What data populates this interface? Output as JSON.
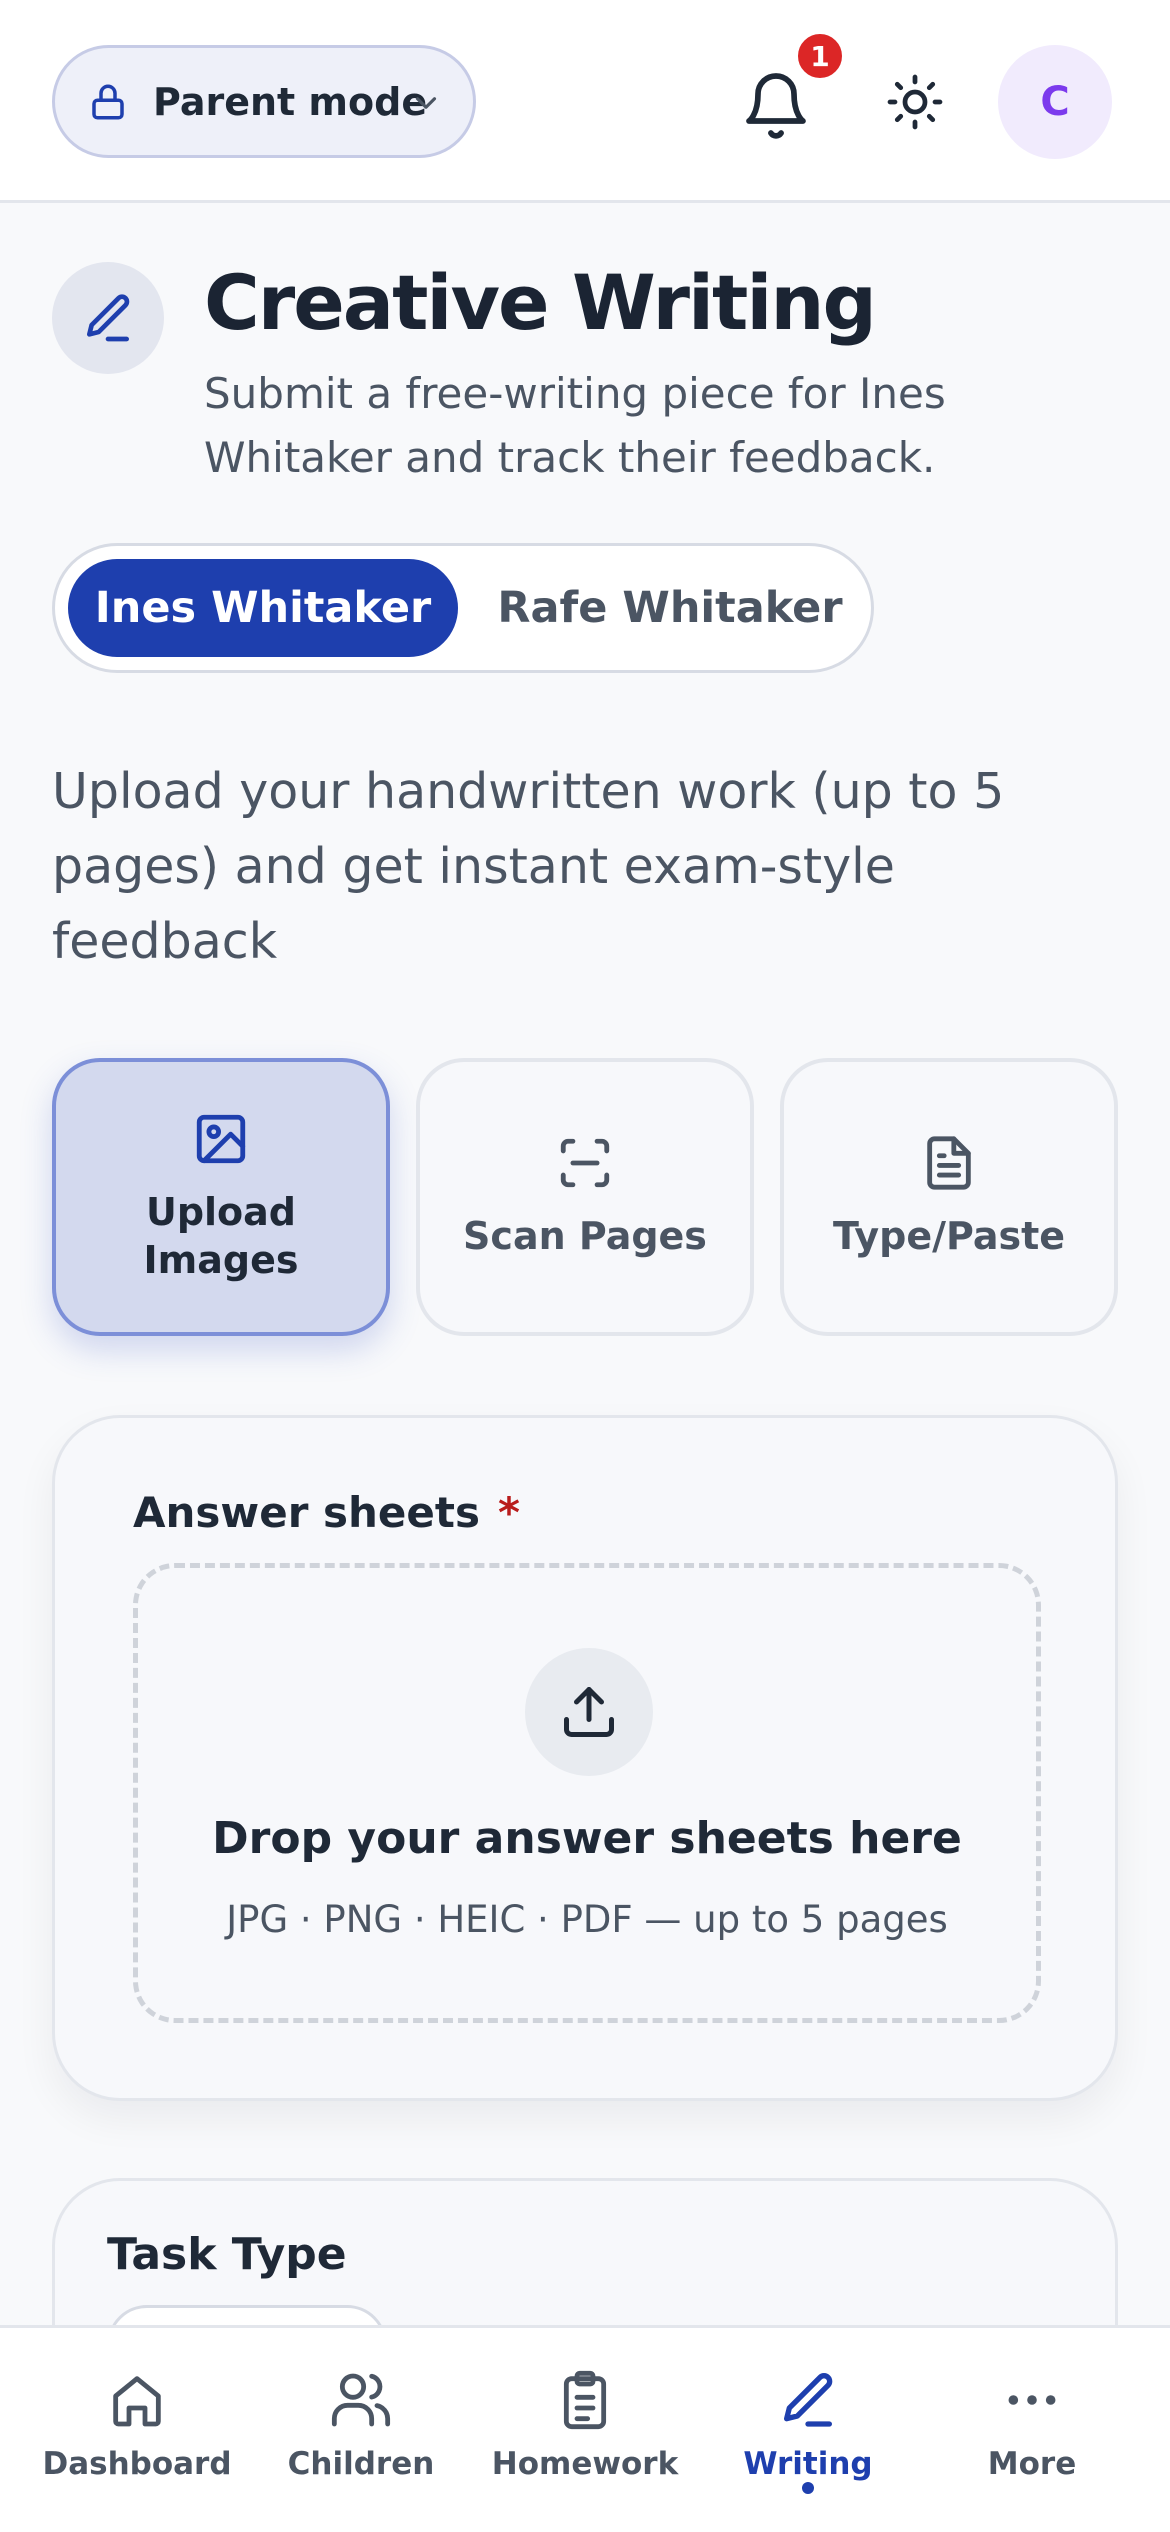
{
  "header": {
    "mode_label": "Parent mode",
    "notification_count": "1",
    "avatar_initial": "C"
  },
  "page": {
    "title": "Creative Writing",
    "subtitle": "Submit a free-writing piece for Ines Whitaker and track their feedback."
  },
  "children_selector": {
    "options": [
      {
        "label": "Ines Whitaker",
        "selected": true
      },
      {
        "label": "Rafe Whitaker",
        "selected": false
      }
    ]
  },
  "intro_text": "Upload your handwritten work (up to 5 pages) and get instant exam-style feedback",
  "methods": [
    {
      "label": "Upload Images",
      "icon": "image-icon",
      "selected": true
    },
    {
      "label": "Scan Pages",
      "icon": "scan-icon",
      "selected": false
    },
    {
      "label": "Type/Paste",
      "icon": "document-icon",
      "selected": false
    }
  ],
  "answer_sheets": {
    "label": "Answer sheets",
    "required_marker": "*",
    "drop_title": "Drop your answer sheets here",
    "drop_subtitle": "JPG · PNG · HEIC · PDF — up to 5 pages"
  },
  "task_type": {
    "label": "Task Type"
  },
  "bottom_nav": [
    {
      "label": "Dashboard",
      "icon": "home-icon",
      "active": false
    },
    {
      "label": "Children",
      "icon": "users-icon",
      "active": false
    },
    {
      "label": "Homework",
      "icon": "clipboard-icon",
      "active": false
    },
    {
      "label": "Writing",
      "icon": "pen-icon",
      "active": true
    },
    {
      "label": "More",
      "icon": "more-icon",
      "active": false
    }
  ],
  "colors": {
    "primary": "#1e3fae",
    "badge": "#dc2626",
    "avatar_text": "#7c3aed",
    "required": "#b91c1c"
  }
}
